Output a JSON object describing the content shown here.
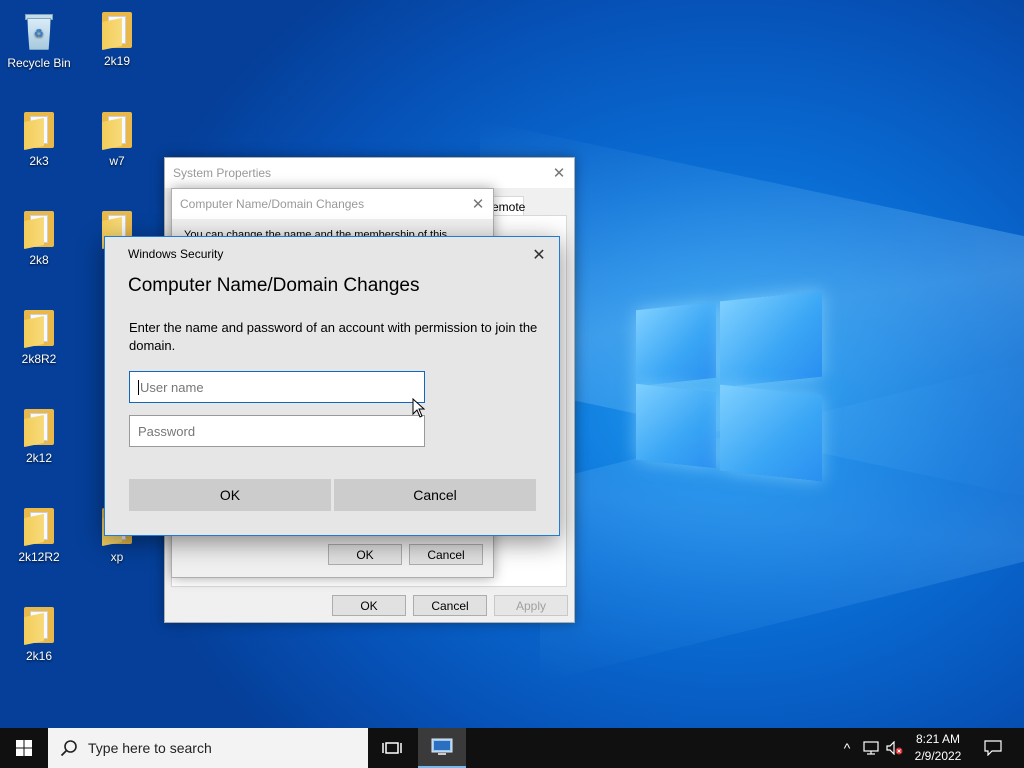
{
  "desktop": {
    "icons": [
      {
        "label": "Recycle Bin",
        "icon": "recycle-bin-icon"
      },
      {
        "label": "2k19",
        "icon": "folder-icon"
      },
      {
        "label": "2k3",
        "icon": "folder-icon"
      },
      {
        "label": "w7",
        "icon": "folder-icon"
      },
      {
        "label": "2k8",
        "icon": "folder-icon"
      },
      {
        "label": "2k8R2",
        "icon": "folder-icon"
      },
      {
        "label": "2k12",
        "icon": "folder-icon"
      },
      {
        "label": "2k12R2",
        "icon": "folder-icon"
      },
      {
        "label": "xp",
        "icon": "folder-icon"
      },
      {
        "label": "2k16",
        "icon": "folder-icon"
      }
    ]
  },
  "system_properties": {
    "title": "System Properties",
    "tab_partial": "emote",
    "ok": "OK",
    "cancel": "Cancel",
    "apply": "Apply"
  },
  "name_changes": {
    "title": "Computer Name/Domain Changes",
    "partial_text": "You can change the name and the membership of this",
    "ok": "OK",
    "cancel": "Cancel"
  },
  "security_dialog": {
    "title": "Windows Security",
    "heading": "Computer Name/Domain Changes",
    "description": "Enter the name and password of an account with permission to join the domain.",
    "username_placeholder": "User name",
    "password_placeholder": "Password",
    "ok": "OK",
    "cancel": "Cancel"
  },
  "taskbar": {
    "search_placeholder": "Type here to search",
    "time": "8:21 AM",
    "date": "2/9/2022"
  }
}
